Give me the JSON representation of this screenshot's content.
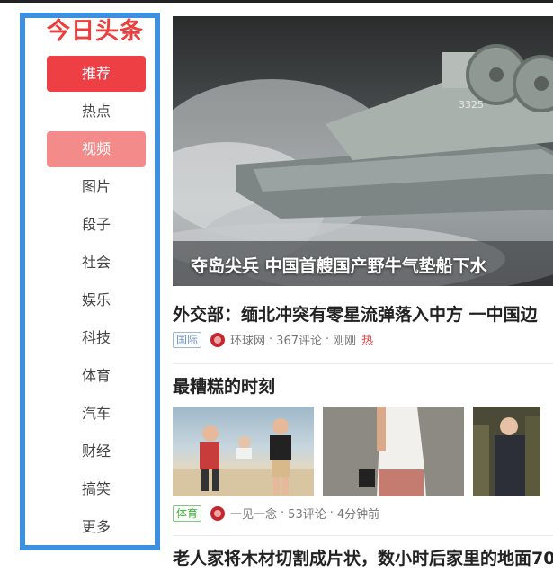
{
  "brand": {
    "logo_text": "今日头条",
    "logo_color": "#ef3c3c",
    "sidebar_border_color": "#3d8fe0"
  },
  "nav": {
    "items": [
      {
        "label": "推荐",
        "state": "active"
      },
      {
        "label": "热点",
        "state": ""
      },
      {
        "label": "视频",
        "state": "hover"
      },
      {
        "label": "图片",
        "state": ""
      },
      {
        "label": "段子",
        "state": ""
      },
      {
        "label": "社会",
        "state": ""
      },
      {
        "label": "娱乐",
        "state": ""
      },
      {
        "label": "科技",
        "state": ""
      },
      {
        "label": "体育",
        "state": ""
      },
      {
        "label": "汽车",
        "state": ""
      },
      {
        "label": "财经",
        "state": ""
      },
      {
        "label": "搞笑",
        "state": ""
      },
      {
        "label": "更多",
        "state": ""
      }
    ]
  },
  "hero": {
    "caption": "夺岛尖兵 中国首艘国产野牛气垫船下水",
    "hull_number": "3325"
  },
  "articles": [
    {
      "title": "外交部：缅北冲突有零星流弹落入中方 一中国边",
      "tag": "国际",
      "source": "环球网",
      "comments": "367评论",
      "time": "刚刚",
      "hot": "热"
    },
    {
      "title": "最糟糕的时刻",
      "tag": "体育",
      "source": "一见一念",
      "comments": "53评论",
      "time": "4分钟前"
    },
    {
      "title": "老人家将木材切割成片状，数小时后家里的地面70"
    }
  ]
}
